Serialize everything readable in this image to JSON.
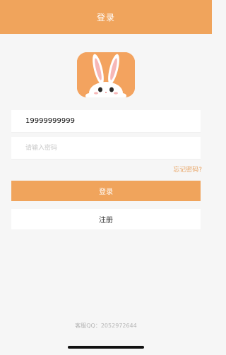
{
  "header": {
    "title": "登录"
  },
  "logo": {
    "icon": "bunny-logo-icon",
    "bg_color": "#f3a35f"
  },
  "login_form": {
    "phone_value": "19999999999",
    "password_placeholder": "请输入密码",
    "forgot_label": "忘记密码?",
    "login_button": "登录",
    "register_button": "注册"
  },
  "footer": {
    "text": "客服QQ：2052972644"
  },
  "colors": {
    "accent": "#f0a45c",
    "background": "#f6f6f6"
  }
}
